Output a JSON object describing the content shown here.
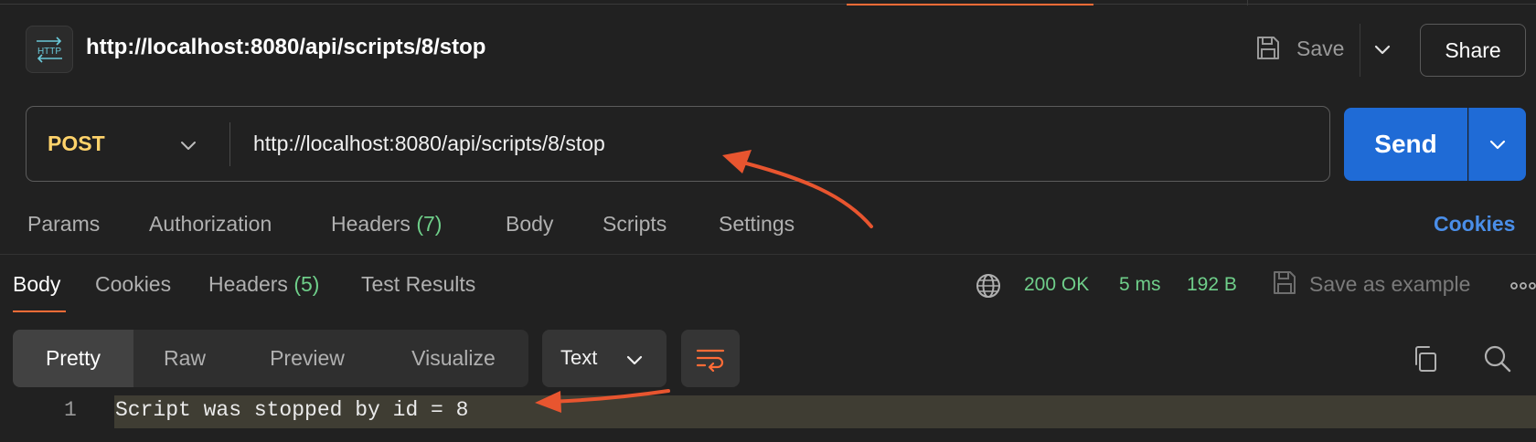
{
  "header": {
    "icon": "http-icon",
    "title": "http://localhost:8080/api/scripts/8/stop",
    "save_label": "Save",
    "share_label": "Share"
  },
  "request": {
    "method": "POST",
    "url": "http://localhost:8080/api/scripts/8/stop",
    "send_label": "Send",
    "tabs": {
      "params": "Params",
      "authorization": "Authorization",
      "headers": "Headers",
      "headers_count": "(7)",
      "body": "Body",
      "scripts": "Scripts",
      "settings": "Settings"
    },
    "cookies_link": "Cookies"
  },
  "response": {
    "tabs": {
      "body": "Body",
      "cookies": "Cookies",
      "headers": "Headers",
      "headers_count": "(5)",
      "test_results": "Test Results"
    },
    "status": "200 OK",
    "time": "5 ms",
    "size": "192 B",
    "save_as_example": "Save as example",
    "view_modes": [
      "Pretty",
      "Raw",
      "Preview",
      "Visualize"
    ],
    "format": "Text",
    "lines": [
      {
        "number": "1",
        "text": "Script was stopped by id = 8"
      }
    ]
  },
  "colors": {
    "accent": "#ff6c37",
    "send": "#1f6bd6",
    "method": "#ffd36b",
    "status_ok": "#6fcf8a",
    "link": "#4a8ee8",
    "annotation_arrow": "#e8552f"
  }
}
